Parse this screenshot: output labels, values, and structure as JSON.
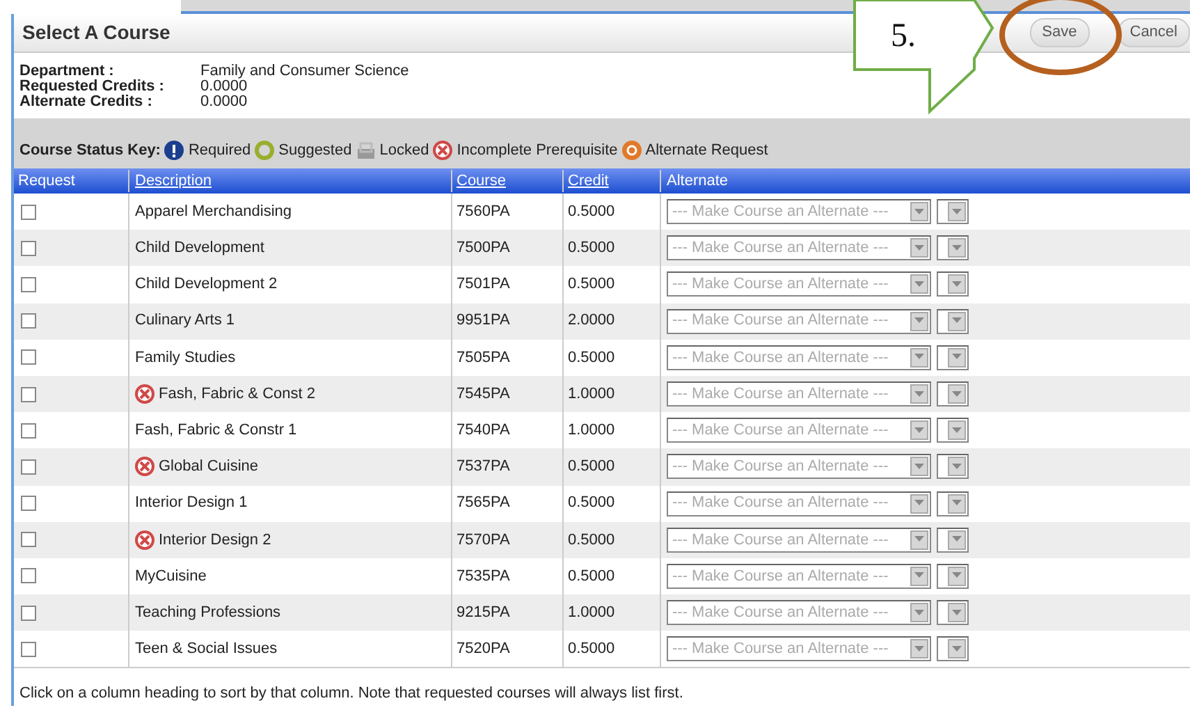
{
  "dialog": {
    "title": "Select A Course",
    "buttons": [
      "Save",
      "Cancel"
    ]
  },
  "info": [
    {
      "label": "Department :",
      "value": "Family and Consumer Science"
    },
    {
      "label": "Requested Credits :",
      "value": "0.0000"
    },
    {
      "label": "Alternate Credits :",
      "value": "0.0000"
    }
  ],
  "status_key": {
    "title": "Course Status Key:",
    "items": [
      {
        "kind": "required",
        "label": "Required"
      },
      {
        "kind": "suggested",
        "label": "Suggested"
      },
      {
        "kind": "locked",
        "label": "Locked"
      },
      {
        "kind": "incomplete_prerequisite",
        "label": "Incomplete Prerequisite"
      },
      {
        "kind": "alternate_request",
        "label": "Alternate Request"
      }
    ]
  },
  "table": {
    "columns": [
      {
        "label": "Request",
        "sortable": false
      },
      {
        "label": "Description",
        "sortable": true
      },
      {
        "label": "Course",
        "sortable": true
      },
      {
        "label": "Credit",
        "sortable": true
      },
      {
        "label": "Alternate",
        "sortable": false
      }
    ],
    "rows": [
      {
        "checked": false,
        "prerequisite_incomplete": false,
        "description": "Apparel Merchandising",
        "course": "7560PA",
        "credit": "0.5000",
        "alternate": "--- Make Course an Alternate ---"
      },
      {
        "checked": false,
        "prerequisite_incomplete": false,
        "description": "Child Development",
        "course": "7500PA",
        "credit": "0.5000",
        "alternate": "--- Make Course an Alternate ---"
      },
      {
        "checked": false,
        "prerequisite_incomplete": false,
        "description": "Child Development 2",
        "course": "7501PA",
        "credit": "0.5000",
        "alternate": "--- Make Course an Alternate ---"
      },
      {
        "checked": false,
        "prerequisite_incomplete": false,
        "description": "Culinary Arts 1",
        "course": "9951PA",
        "credit": "2.0000",
        "alternate": "--- Make Course an Alternate ---"
      },
      {
        "checked": false,
        "prerequisite_incomplete": false,
        "description": "Family Studies",
        "course": "7505PA",
        "credit": "0.5000",
        "alternate": "--- Make Course an Alternate ---"
      },
      {
        "checked": false,
        "prerequisite_incomplete": true,
        "description": "Fash, Fabric & Const 2",
        "course": "7545PA",
        "credit": "1.0000",
        "alternate": "--- Make Course an Alternate ---"
      },
      {
        "checked": false,
        "prerequisite_incomplete": false,
        "description": "Fash, Fabric & Constr 1",
        "course": "7540PA",
        "credit": "1.0000",
        "alternate": "--- Make Course an Alternate ---"
      },
      {
        "checked": false,
        "prerequisite_incomplete": true,
        "description": "Global Cuisine",
        "course": "7537PA",
        "credit": "0.5000",
        "alternate": "--- Make Course an Alternate ---"
      },
      {
        "checked": false,
        "prerequisite_incomplete": false,
        "description": "Interior Design 1",
        "course": "7565PA",
        "credit": "0.5000",
        "alternate": "--- Make Course an Alternate ---"
      },
      {
        "checked": false,
        "prerequisite_incomplete": true,
        "description": "Interior Design 2",
        "course": "7570PA",
        "credit": "0.5000",
        "alternate": "--- Make Course an Alternate ---"
      },
      {
        "checked": false,
        "prerequisite_incomplete": false,
        "description": "MyCuisine",
        "course": "7535PA",
        "credit": "0.5000",
        "alternate": "--- Make Course an Alternate ---"
      },
      {
        "checked": false,
        "prerequisite_incomplete": false,
        "description": "Teaching Professions",
        "course": "9215PA",
        "credit": "1.0000",
        "alternate": "--- Make Course an Alternate ---"
      },
      {
        "checked": false,
        "prerequisite_incomplete": false,
        "description": "Teen & Social Issues",
        "course": "7520PA",
        "credit": "0.5000",
        "alternate": "--- Make Course an Alternate ---"
      }
    ]
  },
  "footer": "Click on a column heading to sort by that column. Note that requested courses will always list first.",
  "annotation": {
    "callout": "5."
  }
}
